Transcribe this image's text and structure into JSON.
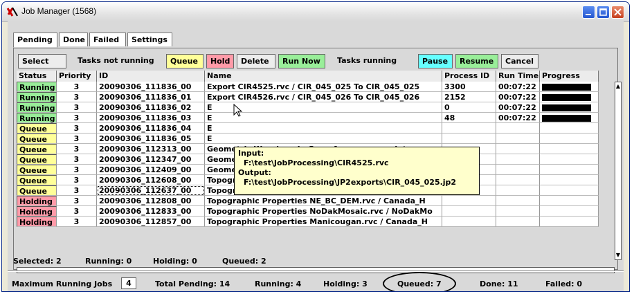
{
  "window": {
    "title": "Job Manager (1568)"
  },
  "tabs": [
    "Pending",
    "Done",
    "Failed",
    "Settings"
  ],
  "toolbar": {
    "select_all": "Select All",
    "tasks_not_running": "Tasks not running",
    "queue": "Queue",
    "hold": "Hold",
    "delete": "Delete",
    "run_now": "Run Now",
    "tasks_running": "Tasks running",
    "pause": "Pause",
    "resume": "Resume",
    "cancel": "Cancel"
  },
  "table": {
    "headers": [
      "Status",
      "Priority",
      "ID",
      "Name",
      "Process ID",
      "Run Time",
      "Progress"
    ],
    "rows": [
      {
        "status": "Running",
        "priority": "3",
        "id": "20090306_111836_00",
        "name": "Export CIR4525.rvc / CIR_045_025 To CIR_045_025",
        "pid": "3300",
        "runtime": "00:07:22",
        "progress": 1.0
      },
      {
        "status": "Running",
        "priority": "3",
        "id": "20090306_111836_01",
        "name": "Export CIR4526.rvc / CIR_045_026 To CIR_045_026",
        "pid": "2152",
        "runtime": "00:07:22",
        "progress": 1.0
      },
      {
        "status": "Running",
        "priority": "3",
        "id": "20090306_111836_02",
        "name": "E",
        "pid": "0",
        "runtime": "00:07:22",
        "progress": 1.0
      },
      {
        "status": "Running",
        "priority": "3",
        "id": "20090306_111836_03",
        "name": "E",
        "pid": "48",
        "runtime": "00:07:22",
        "progress": 1.0
      },
      {
        "status": "Queue",
        "priority": "3",
        "id": "20090306_111836_04",
        "name": "E",
        "pid": "",
        "runtime": "",
        "progress": 0
      },
      {
        "status": "Queue",
        "priority": "3",
        "id": "20090306_111836_05",
        "name": "E",
        "pid": "",
        "runtime": "",
        "progress": 0
      },
      {
        "status": "Queue",
        "priority": "3",
        "id": "20090306_112313_00",
        "name": "Geometric Warping via Georeference nvgeolutm.rvc",
        "pid": "",
        "runtime": "",
        "progress": 0
      },
      {
        "status": "Queue",
        "priority": "3",
        "id": "20090306_112347_00",
        "name": "Geometric Warping via Georeference orgeolutm.rvc",
        "pid": "",
        "runtime": "",
        "progress": 0
      },
      {
        "status": "Queue",
        "priority": "3",
        "id": "20090306_112409_00",
        "name": "Geometric Warping via Georeference utgeolutm.rvc",
        "pid": "",
        "runtime": "",
        "progress": 0
      },
      {
        "status": "Queue",
        "priority": "3",
        "id": "20090306_112608_00",
        "name": "Topographic Properties NC_PA_NED30.rvc / NED30n",
        "pid": "",
        "runtime": "",
        "progress": 0
      },
      {
        "status": "Queue",
        "priority": "3",
        "id": "20090306_112637_00",
        "name": "Topographic Properties HighSierra.rvc / HighSierra",
        "pid": "",
        "runtime": "",
        "progress": 0
      },
      {
        "status": "Holding",
        "priority": "3",
        "id": "20090306_112808_00",
        "name": "Topographic Properties NE_BC_DEM.rvc / Canada_H",
        "pid": "",
        "runtime": "",
        "progress": 0
      },
      {
        "status": "Holding",
        "priority": "3",
        "id": "20090306_112833_00",
        "name": "Topographic Properties NoDakMosaic.rvc / NoDakMo",
        "pid": "",
        "runtime": "",
        "progress": 0
      },
      {
        "status": "Holding",
        "priority": "3",
        "id": "20090306_112857_00",
        "name": "Topographic Properties Manicougan.rvc / Canada_H",
        "pid": "",
        "runtime": "",
        "progress": 0
      }
    ]
  },
  "tooltip": {
    "input_label": "Input:",
    "input_path": "F:\\test\\JobProcessing\\CIR4525.rvc",
    "output_label": "Output:",
    "output_path": "F:\\test\\JobProcessing\\JP2exports\\CIR_045_025.jp2"
  },
  "selection_status": {
    "selected": "Selected: 2",
    "running": "Running: 0",
    "holding": "Holding: 0",
    "queued": "Queued: 2"
  },
  "footer": {
    "max_running_label": "Maximum Running Jobs",
    "max_running_value": "4",
    "total_pending": "Total Pending: 14",
    "running": "Running: 4",
    "holding": "Holding: 3",
    "queued": "Queued: 7",
    "done": "Done: 11",
    "failed": "Failed: 0"
  },
  "colors": {
    "running": "#99ee99",
    "queue": "#ffff99",
    "holding": "#ff9aa8",
    "pause": "#66ffff"
  },
  "icons": [
    "app-icon",
    "minimize-icon",
    "maximize-icon",
    "close-icon",
    "mouse-cursor-icon"
  ]
}
